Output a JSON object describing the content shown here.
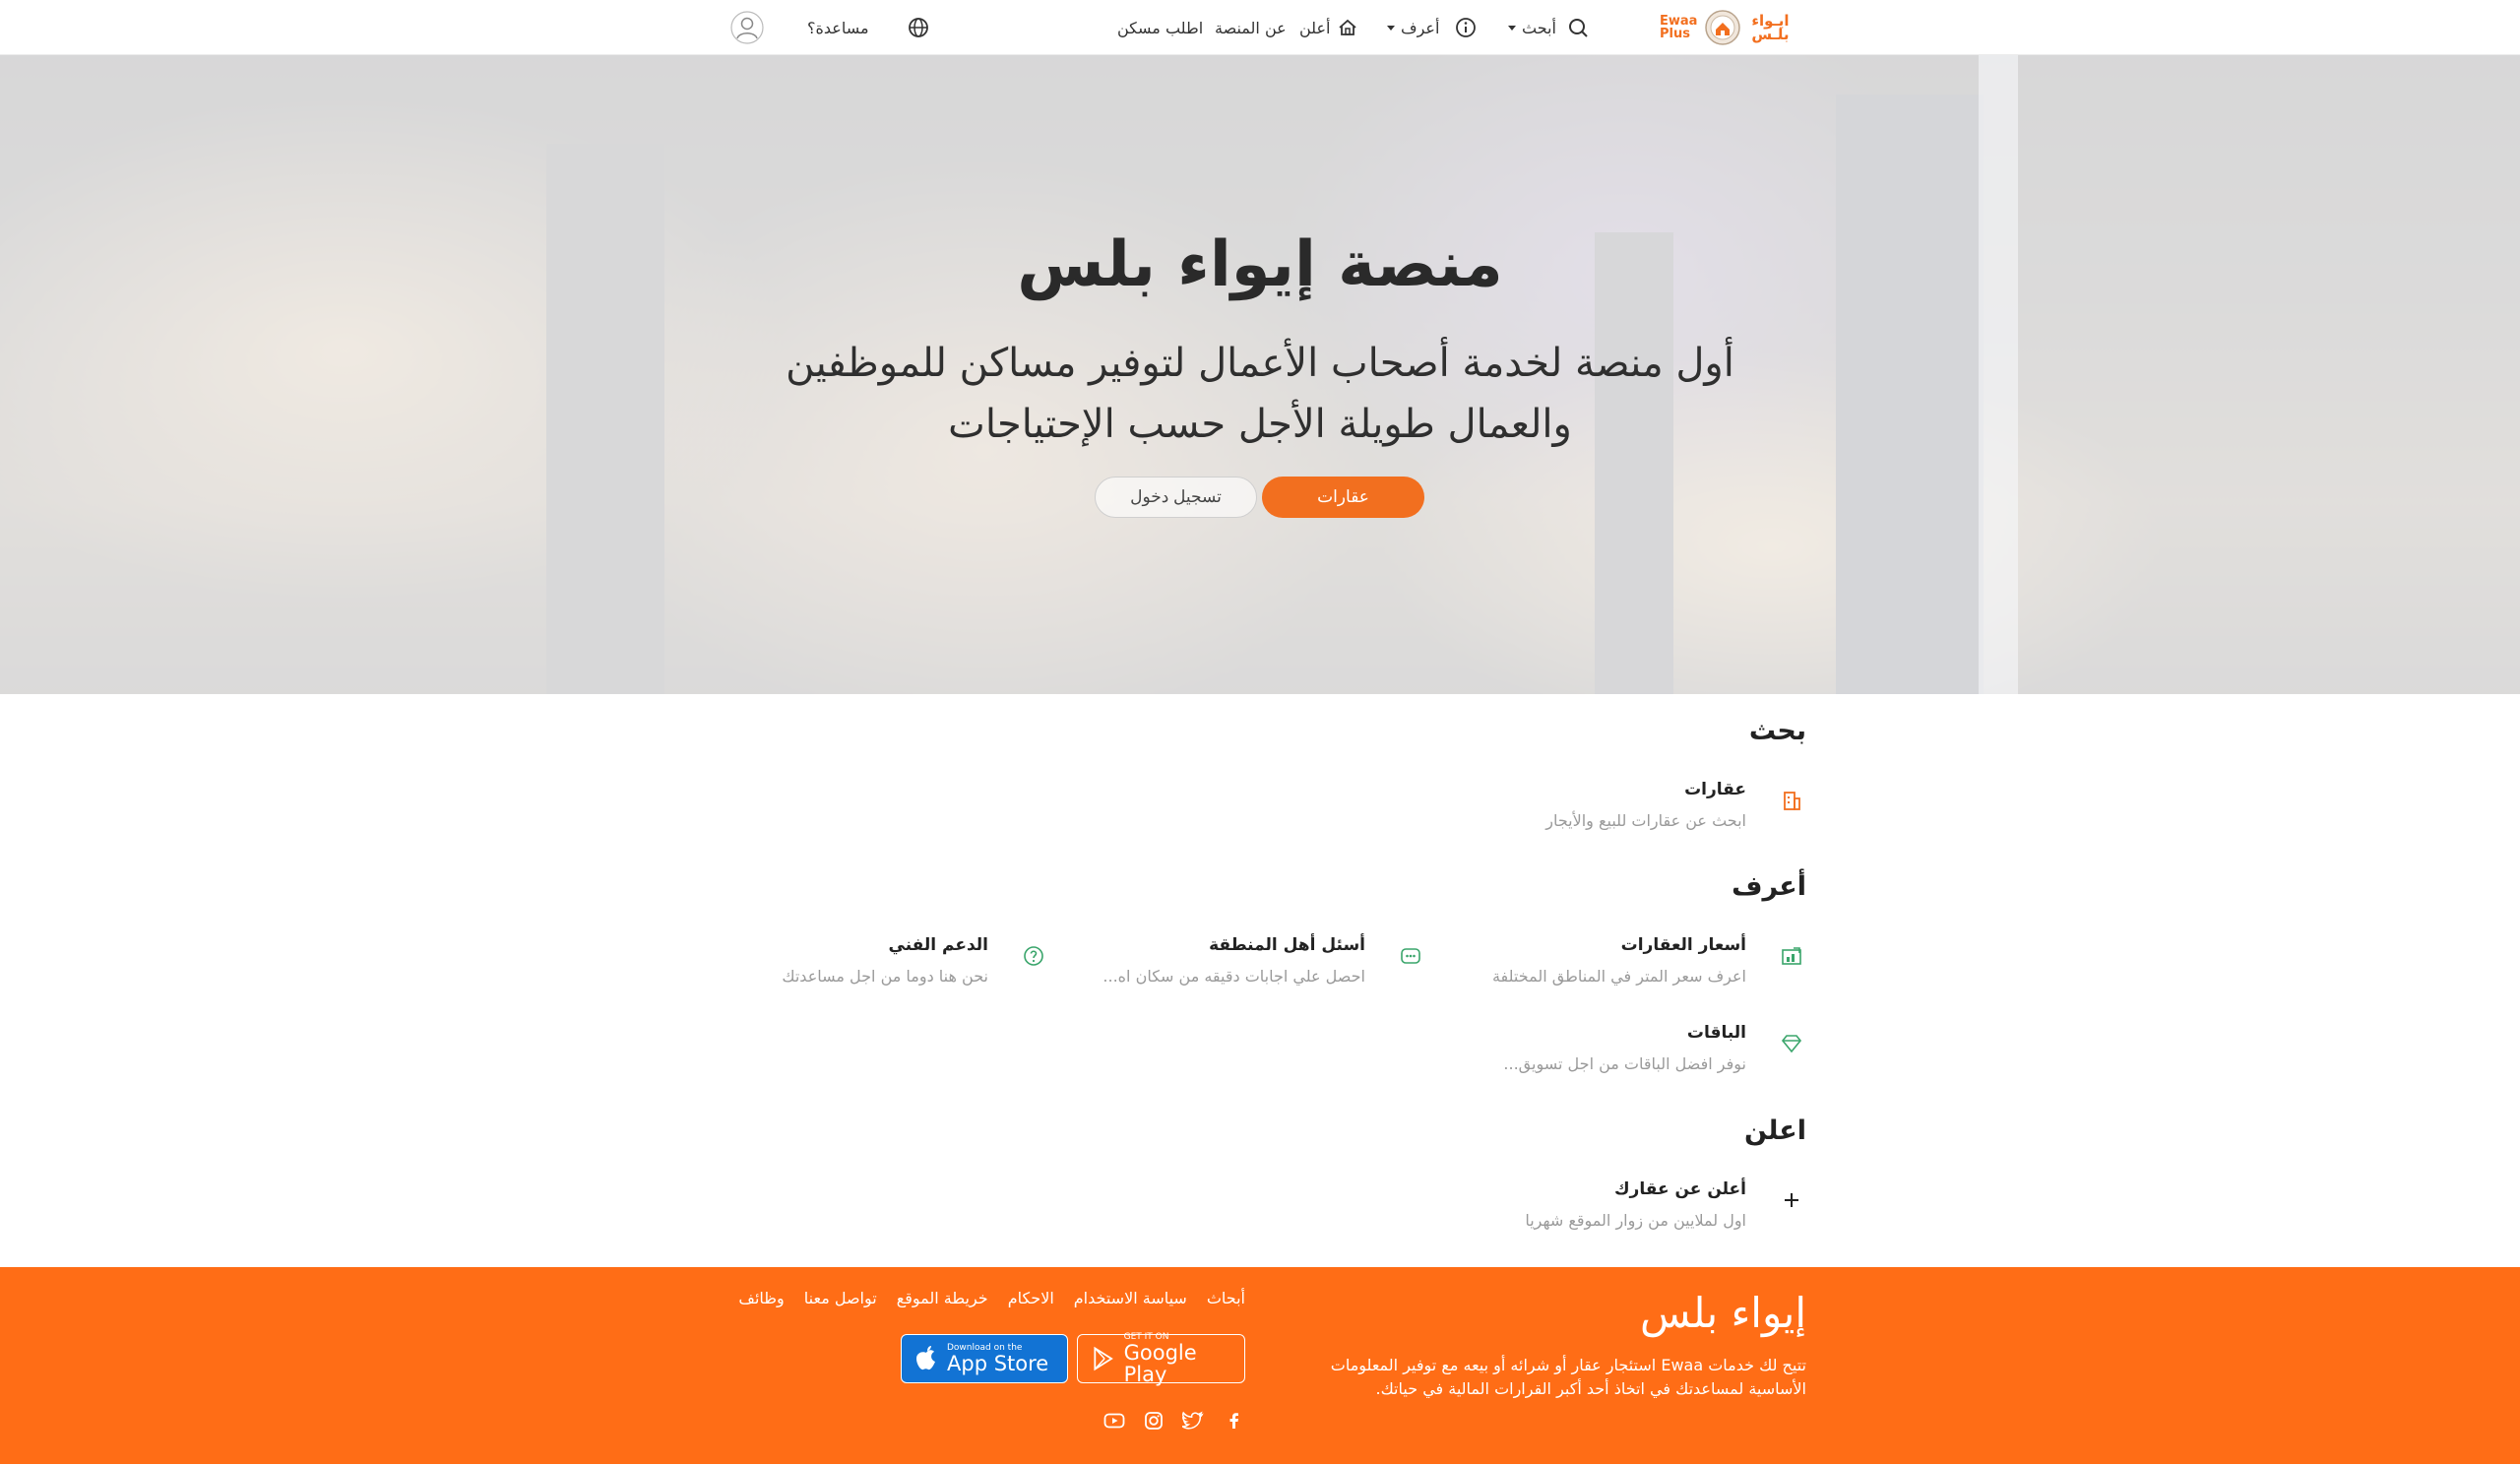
{
  "header": {
    "logo_ar": "ايـواء بلـس",
    "logo_en_line1": "Ewaa",
    "logo_en_line2": "Plus",
    "nav": {
      "search": "أبحث",
      "know": "أعرف",
      "advertise": "أعلن",
      "about": "عن المنصة",
      "request_housing": "اطلب مسكن",
      "help": "مساعدة؟"
    },
    "icons": [
      "search-icon",
      "info-icon",
      "home-icon",
      "globe-icon",
      "user-icon"
    ]
  },
  "hero": {
    "title": "منصة إيواء بلس",
    "subtitle_line1": "أول منصة لخدمة أصحاب الأعمال لتوفير مساكن للموظفين",
    "subtitle_line2": "والعمال طويلة الأجل حسب الإحتياجات",
    "primary_button": "عقارات",
    "secondary_button": "تسجيل دخول"
  },
  "sections": {
    "search": {
      "title": "بحث",
      "items": [
        {
          "title": "عقارات",
          "desc": "ابحث عن عقارات للبيع والأيجار",
          "icon": "building-icon"
        }
      ]
    },
    "know": {
      "title": "أعرف",
      "items": [
        {
          "title": "أسعار العقارات",
          "desc": "اعرف سعر المتر في المناطق المختلفة",
          "icon": "price-chart-icon"
        },
        {
          "title": "أسئل أهل المنطقة",
          "desc": "احصل علي اجابات دقيقه من سكان اه...",
          "icon": "chat-icon"
        },
        {
          "title": "الدعم الفني",
          "desc": "نحن هنا دوما من اجل مساعدتك",
          "icon": "help-circle-icon"
        },
        {
          "title": "الباقات",
          "desc": "نوفر افضل الباقات من اجل تسويق...",
          "icon": "diamond-icon"
        }
      ]
    },
    "advertise": {
      "title": "اعلن",
      "items": [
        {
          "title": "أعلن عن عقارك",
          "desc": "اول لملايين من زوار الموقع شهريا",
          "icon": "plus-icon"
        }
      ]
    }
  },
  "footer": {
    "brand": "إيواء بلس",
    "description": "تتيح لك خدمات Ewaa استئجار عقار أو شرائه أو بيعه مع توفير المعلومات الأساسية لمساعدتك في اتخاذ أحد أكبر القرارات المالية في حياتك.",
    "links": [
      "وظائف",
      "تواصل معنا",
      "خريطة الموقع",
      "الاحكام",
      "سياسة الاستخدام",
      "أبحاث"
    ],
    "google_play_small": "GET IT ON",
    "google_play_big": "Google Play",
    "app_store_small": "Download on the",
    "app_store_big": "App Store",
    "social": [
      "facebook-icon",
      "twitter-icon",
      "instagram-icon",
      "youtube-icon"
    ]
  },
  "colors": {
    "accent": "#f26f1f",
    "footer_bg": "#ff6d16",
    "app_store_bg": "#1273d4",
    "text_muted": "#9a9a9a"
  }
}
